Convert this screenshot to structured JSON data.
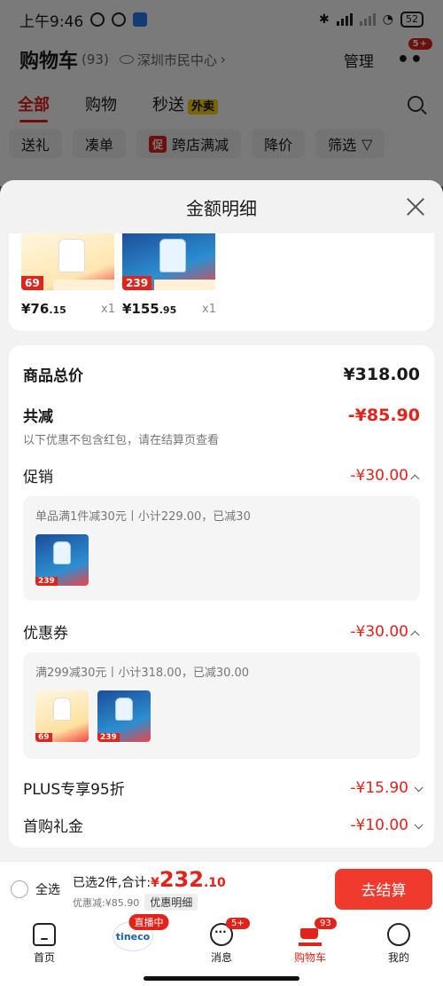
{
  "status": {
    "time": "上午9:46",
    "battery": "52"
  },
  "header": {
    "title": "购物车",
    "count": "(93)",
    "location": "深圳市民中心",
    "manage": "管理",
    "more_badge": "5+"
  },
  "tabs": [
    {
      "label": "全部"
    },
    {
      "label": "购物"
    },
    {
      "label": "秒送",
      "badge": "外卖"
    }
  ],
  "chips": [
    {
      "label": "送礼"
    },
    {
      "label": "凑单"
    },
    {
      "label": "跨店满减",
      "tag": "促"
    },
    {
      "label": "降价"
    },
    {
      "label": "筛选"
    }
  ],
  "sheet": {
    "title": "金额明细",
    "products": [
      {
        "tag": "69",
        "price_main": "¥76",
        "price_dec": ".15",
        "qty": "x1"
      },
      {
        "tag": "239",
        "price_main": "¥155",
        "price_dec": ".95",
        "qty": "x1"
      }
    ],
    "total_label": "商品总价",
    "total_value": "¥318.00",
    "discount_label": "共减",
    "discount_value": "-¥85.90",
    "discount_note": "以下优惠不包含红包，请在结算页查看",
    "promo": {
      "label": "促销",
      "value": "-¥30.00",
      "desc": "单品满1件减30元丨小计229.00，已减30",
      "thumb_tags": [
        "239"
      ]
    },
    "coupon": {
      "label": "优惠券",
      "value": "-¥30.00",
      "desc": "满299减30元丨小计318.00，已减30.00",
      "thumb_tags": [
        "69",
        "239"
      ]
    },
    "plus": {
      "label": "PLUS专享95折",
      "value": "-¥15.90"
    },
    "first": {
      "label": "首购礼金",
      "value": "-¥10.00"
    }
  },
  "checkout": {
    "select_all": "全选",
    "selected_text": "已选2件,合计:",
    "total_symbol": "¥",
    "total_int": "232",
    "total_dec": ".10",
    "discount_text": "优惠减:¥85.90",
    "detail_link": "优惠明细",
    "button": "去结算"
  },
  "tabbar": {
    "home": "首页",
    "live_badge": "直播中",
    "live_logo": "tineco",
    "messages": "消息",
    "messages_badge": "5+",
    "cart": "购物车",
    "cart_badge": "93",
    "me": "我的"
  }
}
